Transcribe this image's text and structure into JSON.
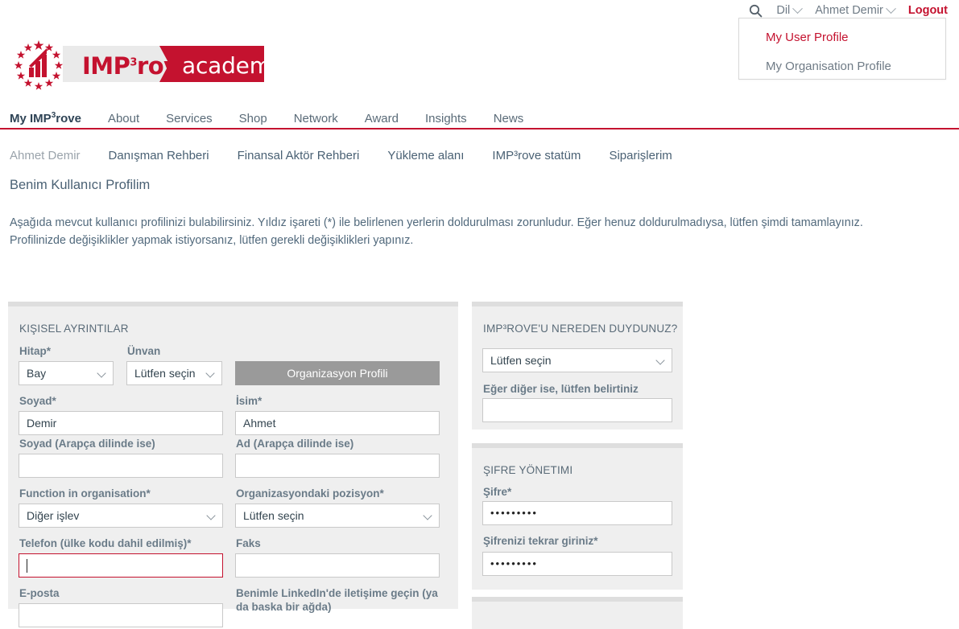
{
  "utility_bar": {
    "search_icon": "search-icon",
    "language": {
      "label": "Dil",
      "caret": "chevron-down-icon"
    },
    "user": {
      "label": "Ahmet Demir",
      "caret": "chevron-down-icon"
    },
    "logout": "Logout",
    "accent_color": "#C4122F"
  },
  "user_dropdown": {
    "items": [
      {
        "label": "My User Profile",
        "active": true
      },
      {
        "label": "My Organisation Profile",
        "active": false
      }
    ]
  },
  "logo": {
    "imp_text": "IMP",
    "imp_sup": "3",
    "imp_rest": "rove",
    "academy_text": "academy",
    "brand_red": "#C4122F",
    "chip_gray": "#eaeaea"
  },
  "main_nav": {
    "items": [
      {
        "label": "My IMP",
        "sup": "3",
        "suffix": "rove",
        "active": true
      },
      {
        "label": "About",
        "active": false
      },
      {
        "label": "Services",
        "active": false
      },
      {
        "label": "Shop",
        "active": false
      },
      {
        "label": "Network",
        "active": false
      },
      {
        "label": "Award",
        "active": false
      },
      {
        "label": "Insights",
        "active": false
      },
      {
        "label": "News",
        "active": false
      }
    ],
    "rule_color": "#C4122F"
  },
  "sub_nav": {
    "items": [
      {
        "label": "Ahmet Demir",
        "current": true
      },
      {
        "label": "Danışman Rehberi",
        "current": false
      },
      {
        "label": "Finansal Aktör Rehberi",
        "current": false
      },
      {
        "label": "Yükleme alanı",
        "current": false
      },
      {
        "label": "IMP³rove statüm",
        "current": false
      },
      {
        "label": "Siparişlerim",
        "current": false
      }
    ]
  },
  "page": {
    "title": "Benim Kullanıcı Profilim",
    "intro": "Aşağıda mevcut kullanıcı profilinizi bulabilirsiniz. Yıldız işareti (*) ile belirlenen yerlerin doldurulması zorunludur. Eğer henuz doldurulmadıysa, lütfen şimdi tamamlayınız. Profilinizde değişiklikler yapmak istiyorsanız, lütfen gerekli değişiklikleri yapınız."
  },
  "personal_panel": {
    "section_title": "KIŞISEL AYRINTILAR",
    "organisation_profile_button": "Organizasyon Profili",
    "fields": {
      "salutation": {
        "label": "Hitap*",
        "value": "Bay"
      },
      "title": {
        "label": "Ünvan",
        "value": "Lütfen seçin"
      },
      "surname": {
        "label": "Soyad*",
        "value": "Demir"
      },
      "firstname": {
        "label": "İsim*",
        "value": "Ahmet"
      },
      "surname_arabic": {
        "label": "Soyad (Arapça dilinde ise)",
        "value": ""
      },
      "firstname_arabic": {
        "label": "Ad (Arapça dilinde ise)",
        "value": ""
      },
      "function": {
        "label": "Function in organisation*",
        "value": "Diğer işlev"
      },
      "position": {
        "label": "Organizasyondaki pozisyon*",
        "value": "Lütfen seçin"
      },
      "phone": {
        "label": "Telefon (ülke kodu dahil edilmiş)*",
        "value": "",
        "error": true
      },
      "fax": {
        "label": "Faks",
        "value": ""
      },
      "email": {
        "label": "E-posta",
        "value": ""
      },
      "linkedin": {
        "label": "Benimle LinkedIn'de iletişime geçin (ya da baska bir ağda)",
        "value": ""
      }
    }
  },
  "heard_panel": {
    "section_title": "IMP³ROVE'U NEREDEN DUYDUNUZ?",
    "source": {
      "value": "Lütfen seçin"
    },
    "other": {
      "label": "Eğer diğer ise, lütfen belirtiniz",
      "value": ""
    }
  },
  "password_panel": {
    "section_title": "ŞIFRE YÖNETIMI",
    "password": {
      "label": "Şifre*",
      "value": "•••••••••"
    },
    "password_repeat": {
      "label": "Şifrenizi tekrar giriniz*",
      "value": "•••••••••"
    }
  }
}
